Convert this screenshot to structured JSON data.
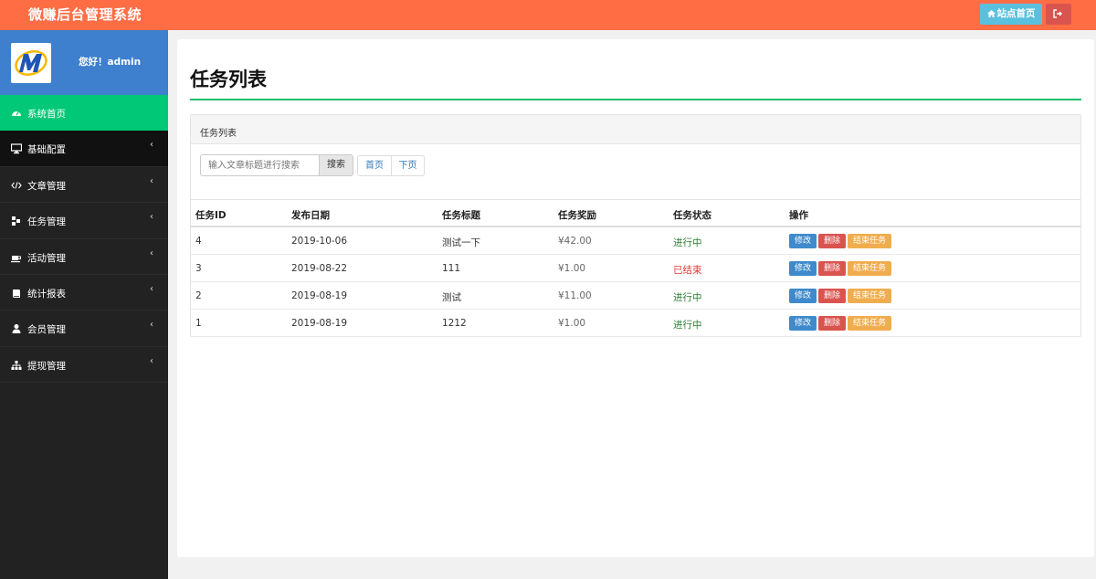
{
  "header": {
    "brand": "微赚后台管理系统",
    "home_button": "站点首页",
    "logout_icon": "sign-out-icon"
  },
  "sidebar": {
    "greeting": "您好！admin",
    "items": [
      {
        "label": "系统首页",
        "icon": "dashboard-icon",
        "active": true
      },
      {
        "label": "基础配置",
        "icon": "desktop-icon"
      },
      {
        "label": "文章管理",
        "icon": "code-icon"
      },
      {
        "label": "任务管理",
        "icon": "cubes-icon"
      },
      {
        "label": "活动管理",
        "icon": "coffee-icon"
      },
      {
        "label": "统计报表",
        "icon": "book-icon"
      },
      {
        "label": "会员管理",
        "icon": "user-icon"
      },
      {
        "label": "提现管理",
        "icon": "sitemap-icon"
      }
    ]
  },
  "main": {
    "title": "任务列表",
    "panel_title": "任务列表",
    "search": {
      "placeholder": "输入文章标题进行搜索",
      "button": "搜索"
    },
    "pager": {
      "first": "首页",
      "next": "下页"
    },
    "columns": [
      "任务ID",
      "发布日期",
      "任务标题",
      "任务奖励",
      "任务状态",
      "操作"
    ],
    "rows": [
      {
        "id": "4",
        "date": "2019-10-06",
        "title": "测试一下",
        "reward": "¥42.00",
        "status": "进行中",
        "status_type": "running"
      },
      {
        "id": "3",
        "date": "2019-08-22",
        "title": "111",
        "reward": "¥1.00",
        "status": "已结束",
        "status_type": "ended"
      },
      {
        "id": "2",
        "date": "2019-08-19",
        "title": "测试",
        "reward": "¥11.00",
        "status": "进行中",
        "status_type": "running"
      },
      {
        "id": "1",
        "date": "2019-08-19",
        "title": "1212",
        "reward": "¥1.00",
        "status": "进行中",
        "status_type": "running"
      }
    ],
    "actions": {
      "edit": "修改",
      "delete": "删除",
      "end": "结束任务"
    }
  },
  "colors": {
    "topbar": "#ff6d45",
    "active_menu": "#00c876",
    "title_rule": "#1fbf6a"
  }
}
